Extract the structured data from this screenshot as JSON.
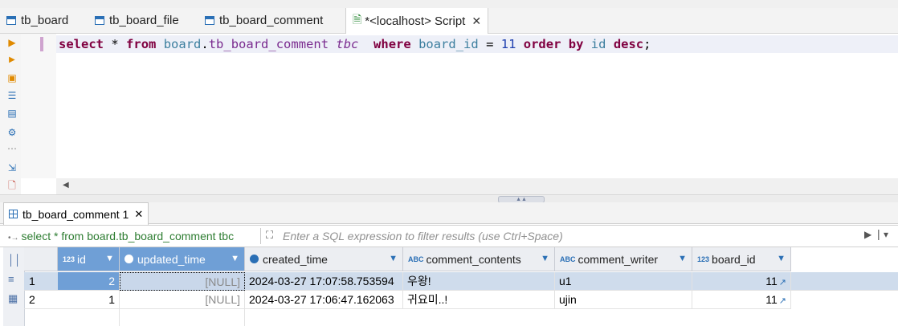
{
  "tabs": [
    {
      "label": "tb_board"
    },
    {
      "label": "tb_board_file"
    },
    {
      "label": "tb_board_comment"
    },
    {
      "label": "*<localhost> Script",
      "active": true
    }
  ],
  "editor": {
    "sql": {
      "kw_select": "select",
      "star": "*",
      "kw_from": "from",
      "schema": "board",
      "dot": ".",
      "table": "tb_board_comment",
      "alias": "tbc",
      "kw_where": "where",
      "col": "board_id",
      "op": "=",
      "value": "11",
      "kw_order": "order",
      "kw_by": "by",
      "order_col": "id",
      "kw_desc": "desc",
      "semi": ";"
    }
  },
  "results": {
    "tab_label": "tb_board_comment 1",
    "query_text": "select * from board.tb_board_comment tbc",
    "filter_placeholder": "Enter a SQL expression to filter results (use Ctrl+Space)",
    "columns": [
      {
        "name": "id",
        "type_icon": "123"
      },
      {
        "name": "updated_time",
        "type_icon": "clock"
      },
      {
        "name": "created_time",
        "type_icon": "clock"
      },
      {
        "name": "comment_contents",
        "type_icon": "ABC"
      },
      {
        "name": "comment_writer",
        "type_icon": "ABC"
      },
      {
        "name": "board_id",
        "type_icon": "123"
      }
    ],
    "rows": [
      {
        "num": "1",
        "id": "2",
        "updated_time": "[NULL]",
        "created_time": "2024-03-27 17:07:58.753594",
        "comment_contents": "우왕!",
        "comment_writer": "u1",
        "board_id": "11"
      },
      {
        "num": "2",
        "id": "1",
        "updated_time": "[NULL]",
        "created_time": "2024-03-27 17:06:47.162063",
        "comment_contents": "귀요미..!",
        "comment_writer": "ujin",
        "board_id": "11"
      }
    ]
  },
  "colors": {
    "keyword": "#800040",
    "identifier": "#3d7f9f",
    "table": "#7a2b8f",
    "number": "#1e3faf",
    "selection": "#6f9fd6",
    "row_highlight": "#cfdcec"
  }
}
